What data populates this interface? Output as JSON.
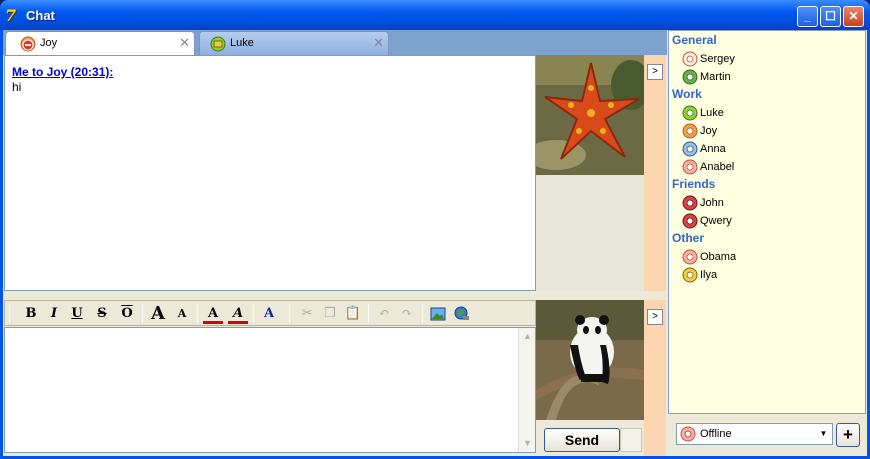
{
  "window": {
    "title": "Chat",
    "icon_glyph": "7"
  },
  "tabs": [
    {
      "label": "Joy",
      "icon": "status-busy-icon"
    },
    {
      "label": "Luke",
      "icon": "status-online-icon"
    }
  ],
  "conversation": {
    "header": "Me to Joy (20:31):",
    "message": "hi"
  },
  "toolbar": {
    "bold": "B",
    "italic": "I",
    "underline": "U",
    "strike": "S",
    "overline": "O",
    "grow": "A",
    "shrink": "A",
    "font_color": "A",
    "highlight": "A",
    "font": "A"
  },
  "send": {
    "label": "Send"
  },
  "contacts": {
    "groups": [
      {
        "name": "General",
        "members": [
          {
            "name": "Sergey",
            "icon": "na-status-icon"
          },
          {
            "name": "Martin",
            "icon": "status-icon"
          }
        ]
      },
      {
        "name": "Work",
        "members": [
          {
            "name": "Luke",
            "icon": "status-online-icon"
          },
          {
            "name": "Joy",
            "icon": "status-busy-icon"
          },
          {
            "name": "Anna",
            "icon": "status-away-icon"
          },
          {
            "name": "Anabel",
            "icon": "status-offline-icon"
          }
        ]
      },
      {
        "name": "Friends",
        "members": [
          {
            "name": "John",
            "icon": "status-dnd-icon"
          },
          {
            "name": "Qwery",
            "icon": "status-dnd-icon"
          }
        ]
      },
      {
        "name": "Other",
        "members": [
          {
            "name": "Obama",
            "icon": "status-offline-icon"
          },
          {
            "name": "Ilya",
            "icon": "status-occupied-icon"
          }
        ]
      }
    ]
  },
  "status": {
    "value": "Offline"
  },
  "add_button": {
    "label": "+"
  }
}
